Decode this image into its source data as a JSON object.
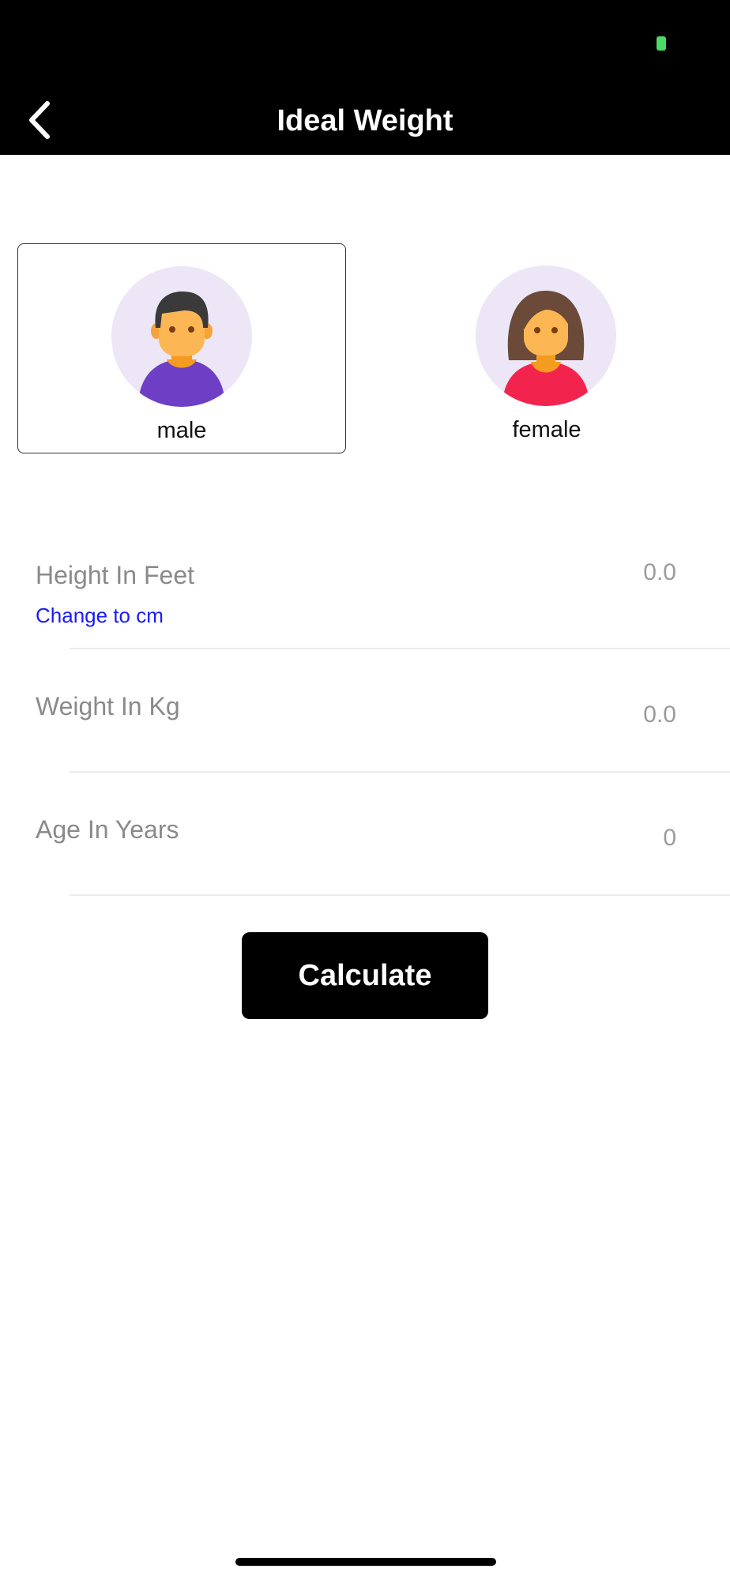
{
  "header": {
    "title": "Ideal Weight",
    "back_icon": "chevron-left-icon"
  },
  "gender": {
    "options": [
      {
        "label": "male",
        "icon": "male-avatar-icon",
        "selected": true
      },
      {
        "label": "female",
        "icon": "female-avatar-icon",
        "selected": false
      }
    ]
  },
  "fields": {
    "height": {
      "label": "Height In Feet",
      "value": "0.0",
      "unit_toggle": "Change to cm"
    },
    "weight": {
      "label": "Weight In Kg",
      "value": "0.0"
    },
    "age": {
      "label": "Age In Years",
      "value": "0"
    }
  },
  "actions": {
    "calculate_label": "Calculate"
  },
  "colors": {
    "header_bg": "#000000",
    "link": "#1a1aff",
    "avatar_bg": "#ece6f6",
    "battery": "#4cd964"
  }
}
